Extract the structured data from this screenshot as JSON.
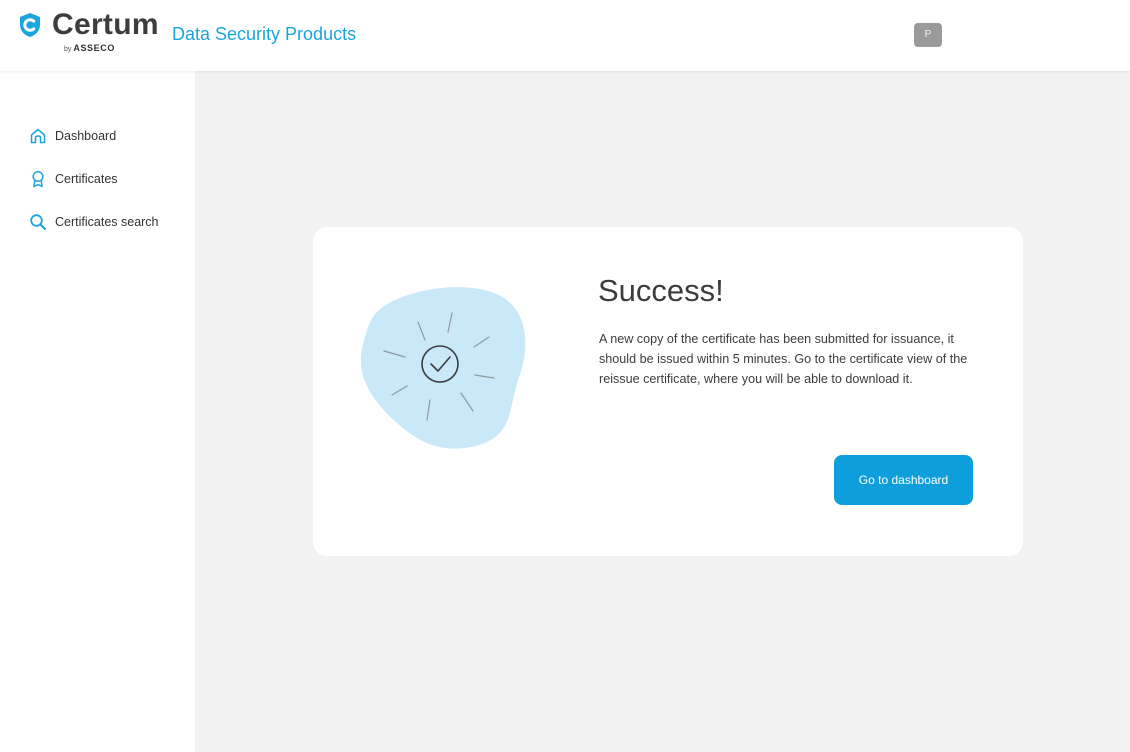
{
  "header": {
    "brand": "Certum",
    "brand_by": "by",
    "brand_parent": "ASSECO",
    "product_title": "Data Security Products",
    "user_initial": "P"
  },
  "sidebar": {
    "items": [
      {
        "label": "Dashboard",
        "icon": "home-icon"
      },
      {
        "label": "Certificates",
        "icon": "award-icon"
      },
      {
        "label": "Certificates search",
        "icon": "search-icon"
      }
    ]
  },
  "main": {
    "title": "Success!",
    "message": "A new copy of the certificate has been submitted for issuance, it should be issued within 5 minutes. Go to the certificate view of the reissue certificate, where you will be able to download it.",
    "button_label": "Go to dashboard"
  },
  "colors": {
    "accent": "#0e9edb",
    "brand_text": "#1aa5dd",
    "background": "#f2f2f2",
    "illustration_blob": "#c9e8f8"
  }
}
